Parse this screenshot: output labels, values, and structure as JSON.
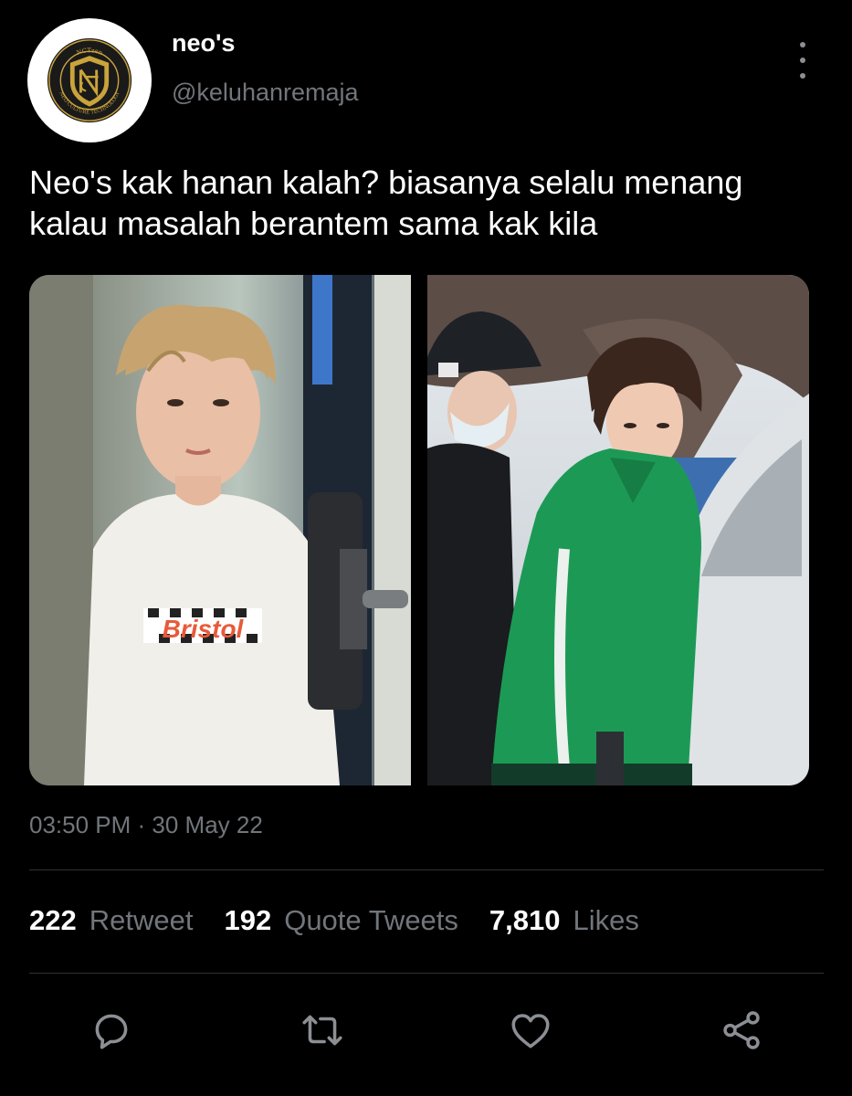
{
  "tweet": {
    "author": {
      "display_name": "neo's",
      "handle": "@keluhanremaja",
      "avatar_ring_text_top": "NCTzen",
      "avatar_ring_text_bottom": "NEO CULTURE TECHNOLOGY"
    },
    "text_line_1": "Neo's kak hanan kalah? biasanya selalu menang",
    "text_line_2": "kalau masalah berantem sama kak kila",
    "media": [
      {
        "description_icon": "photo-left",
        "shirt_print": "Bristol"
      },
      {
        "description_icon": "photo-right"
      }
    ],
    "timestamp": "03:50 PM · 30 May 22",
    "stats": {
      "retweets_count": "222",
      "retweets_label": "Retweet",
      "quotes_count": "192",
      "quotes_label": "Quote Tweets",
      "likes_count": "7,810",
      "likes_label": "Likes"
    },
    "actions": [
      "reply-icon",
      "retweet-icon",
      "like-icon",
      "share-icon"
    ]
  },
  "colors": {
    "background": "#000000",
    "primary_text": "#ffffff",
    "secondary_text": "#71767b",
    "divider": "#2f3336",
    "avatar_gold": "#c9a43a"
  }
}
